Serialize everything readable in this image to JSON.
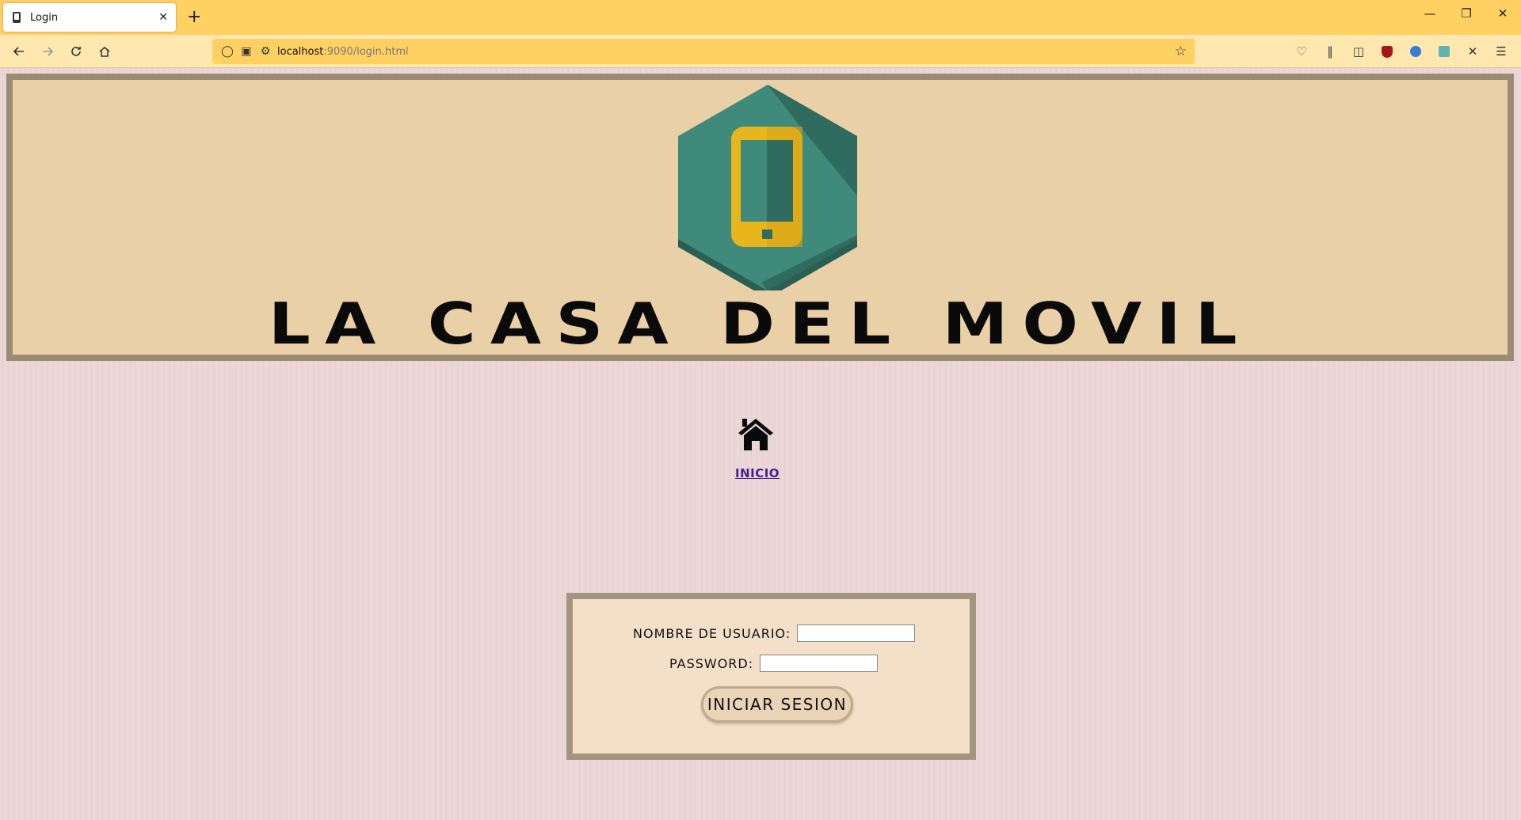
{
  "browser": {
    "tab_title": "Login",
    "url_host": "localhost",
    "url_rest": ":9090/login.html",
    "new_tab": "+",
    "tab_close": "✕"
  },
  "page": {
    "site_title": "LA CASA DEL MOVIL",
    "home_label": "INICIO",
    "form": {
      "username_label": "NOMBRE DE USUARIO:",
      "username_value": "",
      "password_label": "PASSWORD:",
      "password_value": "",
      "submit_label": "INICIAR SESION"
    }
  },
  "colors": {
    "chrome_tab_bar": "#ffd062",
    "header_bg": "#ead0a6",
    "header_border": "#9b8b75",
    "logo_teal": "#3f8a7a",
    "logo_yellow": "#e8b61c",
    "link": "#4a1f8c"
  }
}
